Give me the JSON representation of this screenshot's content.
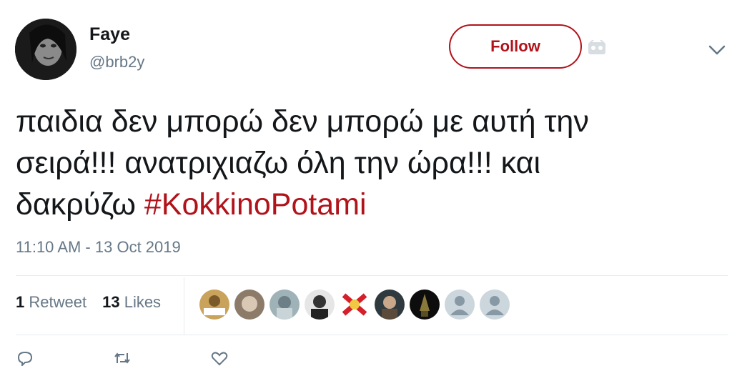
{
  "user": {
    "name": "Faye",
    "handle": "@brb2y"
  },
  "follow_label": "Follow",
  "tweet": {
    "lines": [
      "παιδια δεν μπορώ δεν μπορώ με αυτή την",
      "σειρά!!! ανατριχιαζω όλη την ώρα!!! και",
      "δακρύζω "
    ],
    "hashtag": "#KokkinoPotami",
    "timestamp": "11:10 AM - 13 Oct 2019"
  },
  "stats": {
    "retweets_count": "1",
    "retweets_label": "Retweet",
    "likes_count": "13",
    "likes_label": "Likes"
  },
  "liker_avatars": [
    "avatar-1",
    "avatar-2",
    "avatar-3",
    "avatar-4",
    "avatar-5",
    "avatar-6",
    "avatar-7",
    "default-avatar",
    "default-avatar"
  ],
  "colors": {
    "accent": "#b1131b",
    "text": "#14171a",
    "secondary": "#657786",
    "divider": "#e6ecf0"
  },
  "icons": [
    "brand-icon",
    "chevron-down-icon",
    "reply-icon",
    "retweet-icon",
    "like-icon"
  ]
}
